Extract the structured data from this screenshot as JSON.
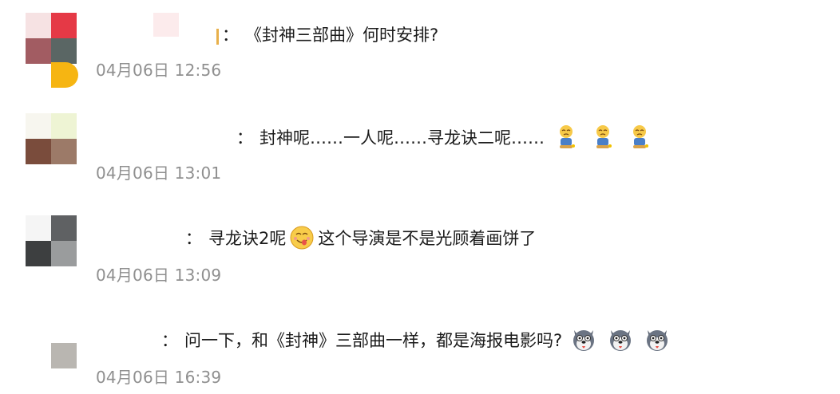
{
  "comments": [
    {
      "prefix": "：",
      "text": "《封神三部曲》何时安排?",
      "time": "04月06日 12:56",
      "emojis": []
    },
    {
      "prefix": "：",
      "text": "封神呢……一人呢……寻龙诀二呢……",
      "time": "04月06日 13:01",
      "emojis": [
        "kneeling-sad-emoji",
        "kneeling-sad-emoji",
        "kneeling-sad-emoji"
      ]
    },
    {
      "prefix": "：",
      "text_before": "寻龙诀2呢",
      "text_after": "这个导演是不是光顾着画饼了",
      "time": "04月06日 13:09",
      "emojis": [
        "yummy-face-emoji"
      ]
    },
    {
      "prefix": "：",
      "text": "问一下，和《封神》三部曲一样，都是海报电影吗?",
      "time": "04月06日 16:39",
      "emojis": [
        "husky-dog-emoji",
        "husky-dog-emoji",
        "husky-dog-emoji"
      ]
    }
  ]
}
